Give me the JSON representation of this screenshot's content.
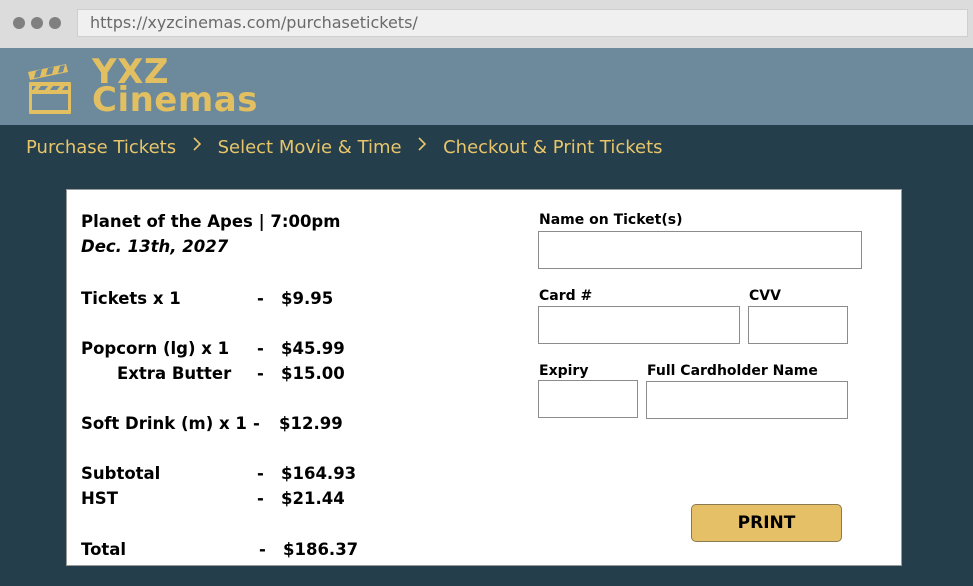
{
  "browser": {
    "url": "https://xyzcinemas.com/purchasetickets/"
  },
  "brand": {
    "line1": "YXZ",
    "line2": "Cinemas",
    "color": "#e2bf61"
  },
  "breadcrumb": {
    "items": [
      "Purchase Tickets",
      "Select Movie & Time",
      "Checkout & Print Tickets"
    ],
    "separator": ">"
  },
  "order": {
    "title": "Planet of the Apes | 7:00pm",
    "date": "Dec. 13th, 2027",
    "lines": [
      {
        "label": "Tickets x 1",
        "dash": "-",
        "amount": "$9.95"
      },
      {
        "label": "Popcorn (lg) x 1",
        "dash": "-",
        "amount": "$45.99"
      },
      {
        "label": "Extra Butter",
        "dash": "-",
        "amount": "$15.00"
      },
      {
        "label": "Soft Drink (m) x 1",
        "dash": "-",
        "amount": "$12.99"
      },
      {
        "label": "Subtotal",
        "dash": "-",
        "amount": "$164.93"
      },
      {
        "label": "HST",
        "dash": "-",
        "amount": "$21.44"
      },
      {
        "label": "Total",
        "dash": "-",
        "amount": "$186.37"
      }
    ]
  },
  "form": {
    "name_label": "Name on Ticket(s)",
    "name_value": "",
    "card_label": "Card #",
    "card_value": "",
    "cvv_label": "CVV",
    "cvv_value": "",
    "expiry_label": "Expiry",
    "expiry_value": "",
    "cardholder_label": "Full Cardholder Name",
    "cardholder_value": "",
    "print_label": "PRINT"
  },
  "colors": {
    "header_bg": "#6c8a9b",
    "page_bg": "#243e4b",
    "accent": "#e8c56a",
    "button": "#e6c066"
  }
}
